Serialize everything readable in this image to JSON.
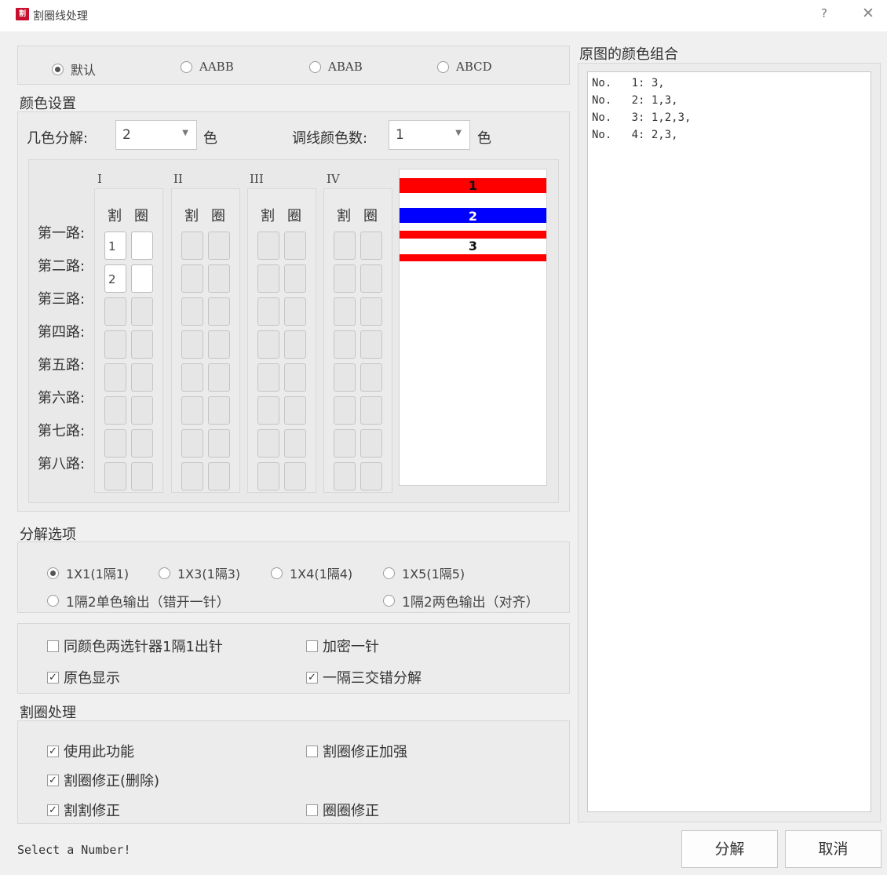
{
  "window": {
    "title": "割圈线处理",
    "icon_text": "割",
    "help": "?",
    "close": "✕"
  },
  "mode": {
    "options": [
      "默认",
      "AABB",
      "ABAB",
      "ABCD"
    ],
    "selected": 0
  },
  "color_settings": {
    "title": "颜色设置",
    "decompose_label": "几色分解:",
    "decompose_value": "2",
    "decompose_unit": "色",
    "adjust_label": "调线颜色数:",
    "adjust_value": "1",
    "adjust_unit": "色",
    "columns": [
      "I",
      "II",
      "III",
      "IV"
    ],
    "sub_headers": [
      "割",
      "圈"
    ],
    "rows": [
      "第一路:",
      "第二路:",
      "第三路:",
      "第四路:",
      "第五路:",
      "第六路:",
      "第七路:",
      "第八路:"
    ],
    "cells": {
      "r1_cut": "1",
      "r2_cut": "2"
    }
  },
  "preview": {
    "stripe_colors": {
      "red": "#ff0000",
      "blue": "#0000ff",
      "white": "#ffffff"
    },
    "labels": [
      "1",
      "2",
      "3"
    ]
  },
  "decompose_options": {
    "title": "分解选项",
    "radios": [
      "1X1(1隔1)",
      "1X3(1隔3)",
      "1X4(1隔4)",
      "1X5(1隔5)",
      "1隔2单色输出（错开一针）",
      "1隔2两色输出（对齐）"
    ],
    "selected": 0
  },
  "checks": [
    {
      "label": "同颜色两选针器1隔1出针",
      "checked": false
    },
    {
      "label": "加密一针",
      "checked": false
    },
    {
      "label": "原色显示",
      "checked": true
    },
    {
      "label": "一隔三交错分解",
      "checked": true
    }
  ],
  "cut_loop": {
    "title": "割圈处理",
    "checks": [
      {
        "label": "使用此功能",
        "checked": true
      },
      {
        "label": "割圈修正加强",
        "checked": false
      },
      {
        "label": "割圈修正(删除)",
        "checked": true
      },
      {
        "label": "割割修正",
        "checked": true
      },
      {
        "label": "圈圈修正",
        "checked": false
      }
    ]
  },
  "color_combo": {
    "title": "原图的颜色组合",
    "lines": [
      "No.   1: 3,",
      "No.   2: 1,3,",
      "No.   3: 1,2,3,",
      "No.   4: 2,3,"
    ]
  },
  "status": "Select a Number!",
  "buttons": {
    "decompose": "分解",
    "cancel": "取消"
  }
}
